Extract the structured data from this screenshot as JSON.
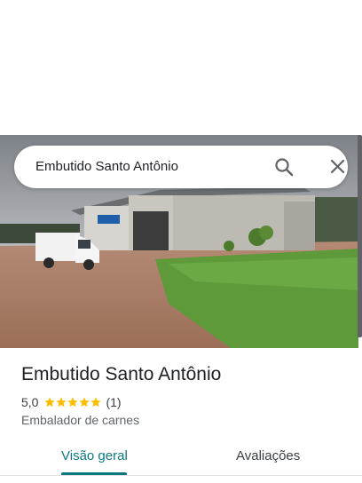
{
  "search": {
    "query": "Embutido Santo Antônio"
  },
  "icons": {
    "search": "search-icon",
    "close": "close-icon",
    "star": "star-icon"
  },
  "place": {
    "name": "Embutido Santo Antônio",
    "rating": "5,0",
    "stars": 5,
    "review_count": "(1)",
    "category": "Embalador de carnes"
  },
  "tabs": [
    {
      "label": "Visão geral",
      "selected": true
    },
    {
      "label": "Avaliações",
      "selected": false
    }
  ],
  "colors": {
    "accent": "#0b7a80",
    "star": "#fbbc04",
    "text_primary": "#202124",
    "text_secondary": "#5f6368"
  }
}
